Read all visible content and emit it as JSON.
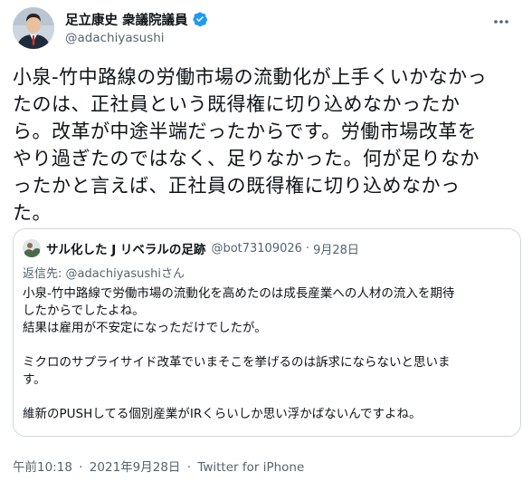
{
  "author": {
    "display_name": "足立康史 衆議院議員",
    "handle": "@adachiyasushi"
  },
  "tweet": {
    "lines": [
      "小泉-竹中路線の労働市場の流動化が上手くいかなかっ",
      "たのは、正社員という既得権に切り込めなかったか",
      "ら。改革が中途半端だったからです。労働市場改革を",
      "やり過ぎたのではなく、足りなかった。何が足りなか",
      "ったかと言えば、正社員の既得権に切り込めなかっ",
      "た。"
    ]
  },
  "quoted": {
    "display_name": "サル化した J リベラルの足跡",
    "handle": "@bot73109026",
    "separator": "·",
    "date": "9月28日",
    "reply_prefix": "返信先: ",
    "reply_mention": "@adachiyasushi",
    "reply_suffix": "さん",
    "lines": [
      "小泉-竹中路線で労働市場の流動化を高めたのは成長産業への人材の流入を期待",
      "したからでしたよね。",
      "結果は雇用が不安定になっただけでしたが。",
      "",
      "ミクロのサプライサイド改革でいまそこを挙げるのは訴求にならないと思いま",
      "す。",
      "",
      "維新のPUSHしてる個別産業がIRくらいしか思い浮かばないんですよね。"
    ]
  },
  "footer": {
    "time": "午前10:18",
    "separator": "·",
    "date": "2021年9月28日",
    "source": "Twitter for iPhone"
  },
  "icons": {
    "verified": "verified-badge-icon",
    "more": "more-options-icon"
  },
  "colors": {
    "text": "#0f1419",
    "secondary": "#536471",
    "verified": "#1d9bf0",
    "border": "#cfd9de"
  }
}
